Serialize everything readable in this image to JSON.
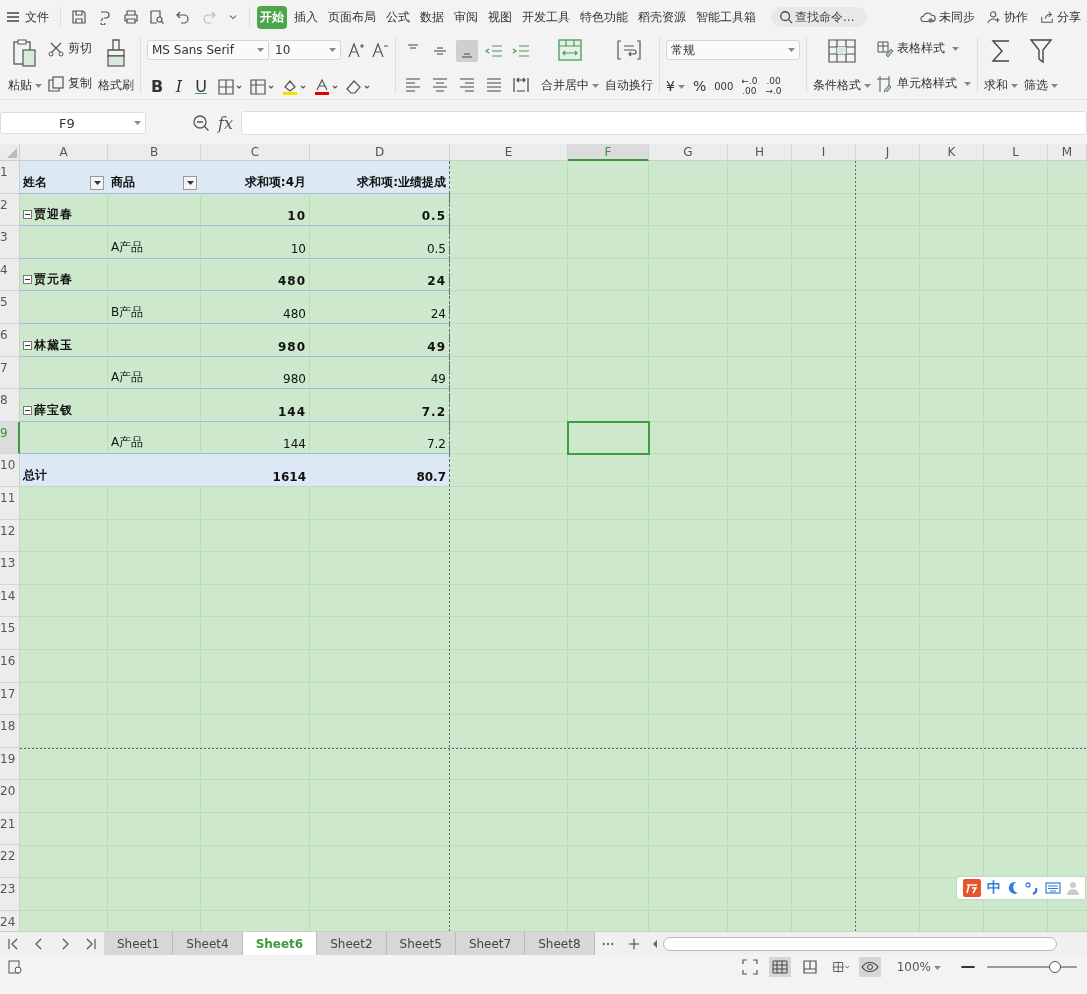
{
  "menu": {
    "file": "文件",
    "tabs": [
      {
        "label": "开始",
        "selected": true
      },
      {
        "label": "插入",
        "selected": false
      },
      {
        "label": "页面布局",
        "selected": false
      },
      {
        "label": "公式",
        "selected": false
      },
      {
        "label": "数据",
        "selected": false
      },
      {
        "label": "审阅",
        "selected": false
      },
      {
        "label": "视图",
        "selected": false
      },
      {
        "label": "开发工具",
        "selected": false
      },
      {
        "label": "特色功能",
        "selected": false
      },
      {
        "label": "稻壳资源",
        "selected": false
      },
      {
        "label": "智能工具箱",
        "selected": false
      }
    ],
    "search": {
      "placeholder": "查找命令..."
    },
    "sync": "未同步",
    "collab": "协作",
    "share": "分享"
  },
  "ribbon": {
    "paste": "粘贴",
    "cut": "剪切",
    "copy": "复制",
    "format_painter": "格式刷",
    "font": "MS Sans Serif",
    "font_size": "10",
    "bold": "B",
    "italic": "I",
    "underline": "U",
    "vertical_align": [
      {
        "selected": false
      },
      {
        "selected": false
      },
      {
        "selected": true
      }
    ],
    "merge": "合并居中",
    "wrap": "自动换行",
    "number_format": "常规",
    "currency": "¥",
    "percent": "%",
    "thousands": "000",
    "increase_decimal": {
      "top": "←.0",
      "bottom": ".00"
    },
    "decrease_decimal": {
      "top": ".00",
      "bottom": "→.0"
    },
    "conditional": "条件格式",
    "table_style": "表格样式",
    "cell_style": "单元格样式",
    "sum": "求和",
    "filter": "筛选"
  },
  "formula_bar": {
    "name_box": "F9",
    "fx": "fx"
  },
  "sheet": {
    "columns": [
      {
        "label": "A",
        "selected": false
      },
      {
        "label": "B",
        "selected": false
      },
      {
        "label": "C",
        "selected": false
      },
      {
        "label": "D",
        "selected": false
      },
      {
        "label": "E",
        "selected": false
      },
      {
        "label": "F",
        "selected": true
      },
      {
        "label": "G",
        "selected": false
      },
      {
        "label": "H",
        "selected": false
      },
      {
        "label": "I",
        "selected": false
      },
      {
        "label": "J",
        "selected": false
      },
      {
        "label": "K",
        "selected": false
      },
      {
        "label": "L",
        "selected": false
      },
      {
        "label": "M",
        "selected": false
      }
    ],
    "row_numbers": [
      {
        "label": "1",
        "selected": false
      },
      {
        "label": "2",
        "selected": false
      },
      {
        "label": "3",
        "selected": false
      },
      {
        "label": "4",
        "selected": false
      },
      {
        "label": "5",
        "selected": false
      },
      {
        "label": "6",
        "selected": false
      },
      {
        "label": "7",
        "selected": false
      },
      {
        "label": "8",
        "selected": false
      },
      {
        "label": "9",
        "selected": true
      },
      {
        "label": "10",
        "selected": false
      },
      {
        "label": "11",
        "selected": false
      },
      {
        "label": "12",
        "selected": false
      },
      {
        "label": "13",
        "selected": false
      },
      {
        "label": "14",
        "selected": false
      },
      {
        "label": "15",
        "selected": false
      },
      {
        "label": "16",
        "selected": false
      },
      {
        "label": "17",
        "selected": false
      },
      {
        "label": "18",
        "selected": false
      },
      {
        "label": "19",
        "selected": false
      },
      {
        "label": "20",
        "selected": false
      },
      {
        "label": "21",
        "selected": false
      },
      {
        "label": "22",
        "selected": false
      },
      {
        "label": "23",
        "selected": false
      },
      {
        "label": "24",
        "selected": false
      }
    ],
    "pivot_rows": [
      {
        "kind": "header",
        "cells": [
          {
            "text": "姓名",
            "dropdown": true
          },
          {
            "text": "商品",
            "dropdown": true
          },
          {
            "text": "求和项:4月",
            "dropdown": false
          },
          {
            "text": "求和项:业绩提成",
            "dropdown": false
          }
        ]
      },
      {
        "kind": "group",
        "expanded": true,
        "cells": [
          "贾迎春",
          "",
          "10",
          "0.5"
        ]
      },
      {
        "kind": "item",
        "cells": [
          "",
          "A产品",
          "10",
          "0.5"
        ]
      },
      {
        "kind": "group",
        "expanded": true,
        "cells": [
          "贾元春",
          "",
          "480",
          "24"
        ]
      },
      {
        "kind": "item",
        "cells": [
          "",
          "B产品",
          "480",
          "24"
        ]
      },
      {
        "kind": "group",
        "expanded": true,
        "cells": [
          "林黛玉",
          "",
          "980",
          "49"
        ]
      },
      {
        "kind": "item",
        "cells": [
          "",
          "A产品",
          "980",
          "49"
        ]
      },
      {
        "kind": "group",
        "expanded": true,
        "cells": [
          "薛宝钗",
          "",
          "144",
          "7.2"
        ]
      },
      {
        "kind": "item",
        "cells": [
          "",
          "A产品",
          "144",
          "7.2"
        ]
      },
      {
        "kind": "total",
        "cells": [
          "总计",
          "",
          "1614",
          "80.7"
        ]
      }
    ]
  },
  "sheet_tabs": [
    {
      "label": "Sheet1",
      "selected": false
    },
    {
      "label": "Sheet4",
      "selected": false
    },
    {
      "label": "Sheet6",
      "selected": true
    },
    {
      "label": "Sheet2",
      "selected": false
    },
    {
      "label": "Sheet5",
      "selected": false
    },
    {
      "label": "Sheet7",
      "selected": false
    },
    {
      "label": "Sheet8",
      "selected": false
    }
  ],
  "status": {
    "zoom": "100%",
    "zoom_slider": {
      "level": 0.75
    }
  },
  "ime": {
    "mode": "中"
  }
}
